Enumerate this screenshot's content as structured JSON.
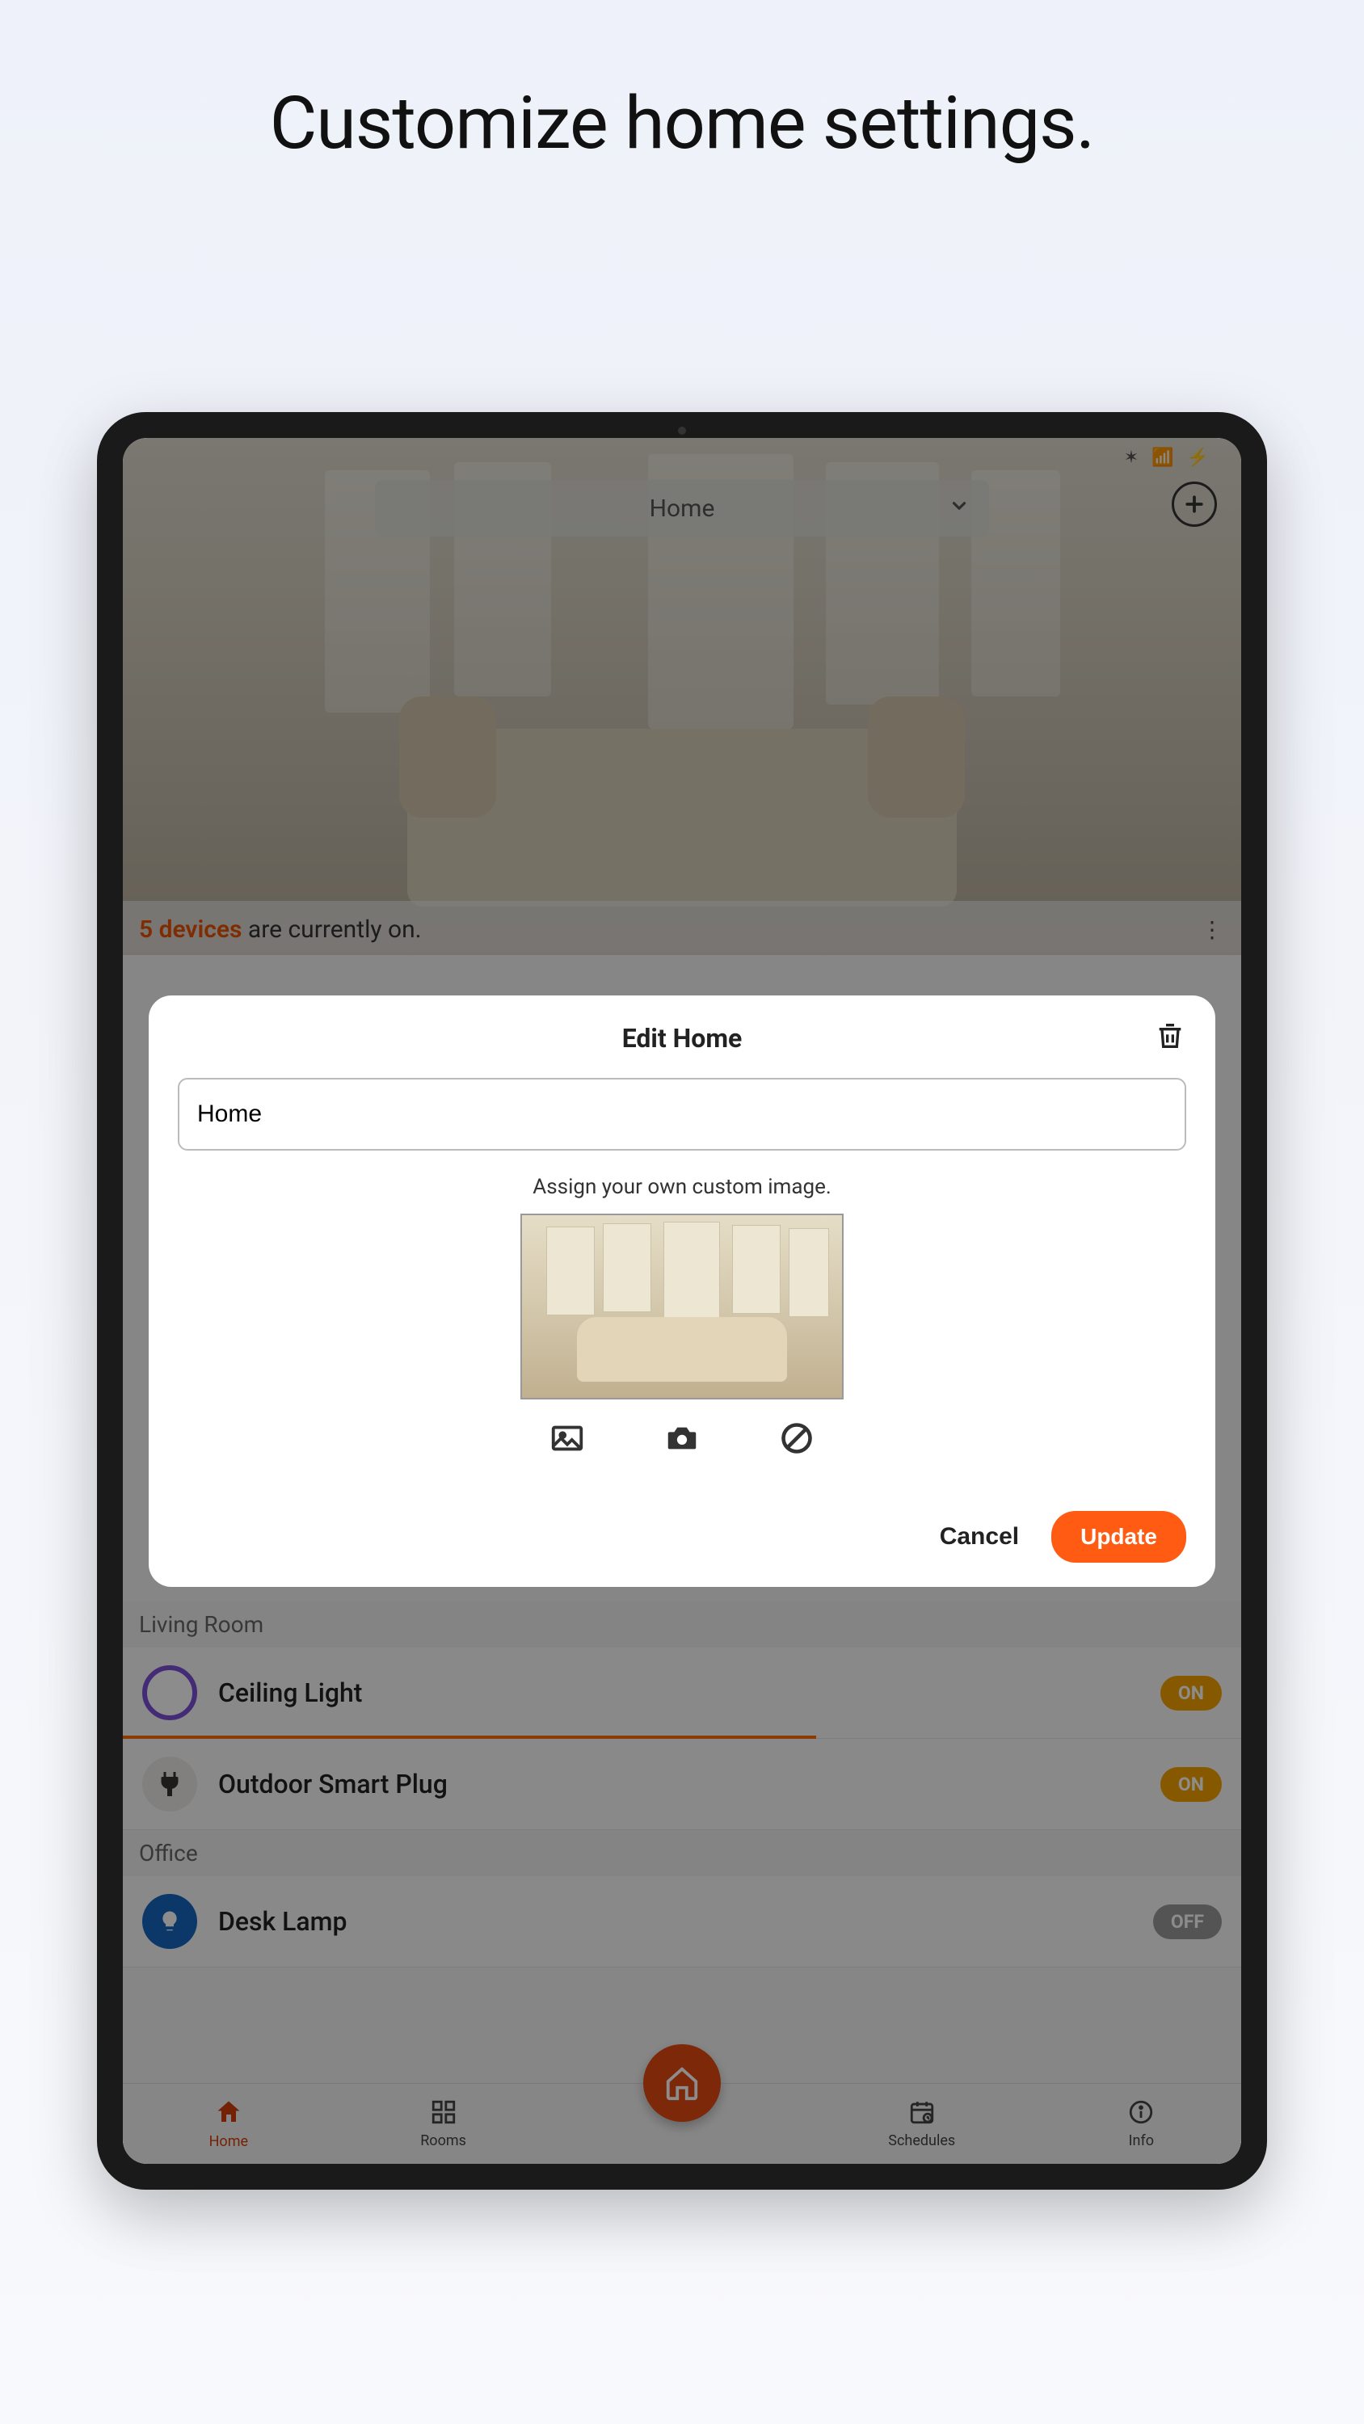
{
  "page_title": "Customize home settings.",
  "dropdown": {
    "label": "Home"
  },
  "devices_on": {
    "count": "5 devices",
    "text": " are currently on."
  },
  "rooms": [
    {
      "name": "Living Room",
      "devices": [
        {
          "name": "Ceiling Light",
          "state": "ON",
          "on": true,
          "progress": true,
          "icon": "bulb-color"
        },
        {
          "name": "Outdoor Smart Plug",
          "state": "ON",
          "on": true,
          "icon": "plug"
        }
      ]
    },
    {
      "name": "Office",
      "devices": [
        {
          "name": "Desk Lamp",
          "state": "OFF",
          "on": false,
          "icon": "bulb-blue"
        }
      ]
    }
  ],
  "nav": {
    "home": "Home",
    "rooms": "Rooms",
    "schedules": "Schedules",
    "info": "Info"
  },
  "modal": {
    "title": "Edit Home",
    "name_value": "Home",
    "subtext": "Assign your own custom image.",
    "cancel": "Cancel",
    "update": "Update"
  },
  "colors": {
    "accent": "#ff5b12",
    "on_badge": "#f5a300",
    "off_badge": "#9a9a9a"
  }
}
